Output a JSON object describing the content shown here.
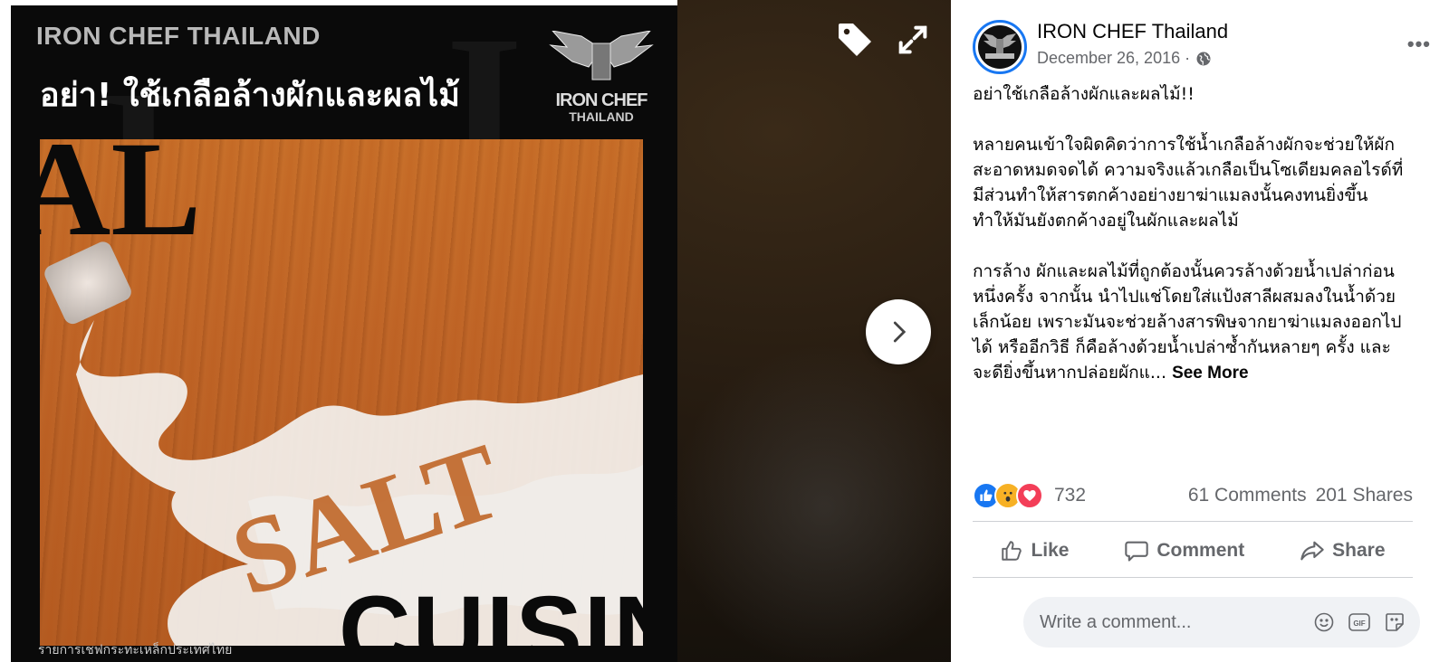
{
  "photo": {
    "brand": "IRON CHEF THAILAND",
    "headline": "อย่า! ใช้เกลือล้างผักและผลไม้",
    "logo_text": "IRON CHEF",
    "logo_sub": "THAILAND",
    "big_letters": "AL",
    "cuisine_text": "CUISIN",
    "caption": "รายการเชฟกระทะเหล็กประเทศไทย"
  },
  "viewer": {
    "tag_icon": "tag-icon",
    "expand_icon": "expand-icon",
    "next_icon": "chevron-right-icon"
  },
  "post": {
    "page_name": "IRON CHEF Thailand",
    "date": "December 26, 2016 ·",
    "privacy_icon": "globe-icon",
    "more_label": "•••",
    "paragraph_1": "อย่าใช้เกลือล้างผักและผลไม้!!",
    "paragraph_2": "หลายคนเข้าใจผิดคิดว่าการใช้น้ำเกลือล้างผักจะช่วยให้ผักสะอาดหมดจดได้ ความจริงแล้วเกลือเป็นโซเดียมคลอไรด์ที่มีส่วนทำให้สารตกค้างอย่างยาฆ่าแมลงนั้นคงทนยิ่งขึ้น ทำให้มันยังตกค้างอยู่ในผักและผลไม้",
    "paragraph_3": "การล้าง ผักและผลไม้ที่ถูกต้องนั้นควรล้างด้วยน้ำเปล่าก่อนหนึ่งครั้ง จากนั้น นำไปแช่โดยใส่แป้งสาลีผสมลงในน้ำด้วยเล็กน้อย เพราะมันจะช่วยล้างสารพิษจากยาฆ่าแมลงออกไปได้ หรืออีกวิธี ก็คือล้างด้วยน้ำเปล่าซ้ำกันหลายๆ ครั้ง และจะดียิ่งขึ้นหากปล่อยผักแ...",
    "see_more": "See More"
  },
  "stats": {
    "reaction_count": "732",
    "comments": "61 Comments",
    "shares": "201 Shares"
  },
  "actions": {
    "like": "Like",
    "comment": "Comment",
    "share": "Share"
  },
  "comment_box": {
    "placeholder": "Write a comment..."
  },
  "colors": {
    "accent": "#1877f2",
    "secondary_text": "#65676b",
    "wood": "#c06628"
  }
}
